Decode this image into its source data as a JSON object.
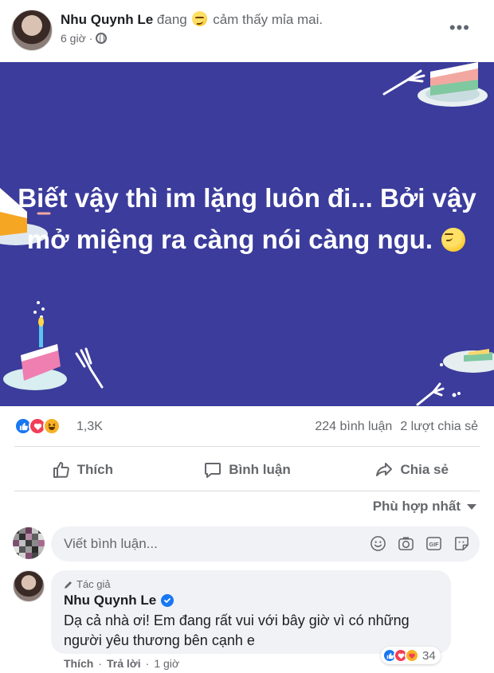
{
  "post": {
    "author": "Nhu Quynh Le",
    "feeling_prefix": "đang",
    "feeling_text": "cảm thấy mỉa mai.",
    "feeling_emoji": "smirk-emoji",
    "time": "6 giờ",
    "separator": "·",
    "privacy_icon": "globe-icon",
    "more_label": "•••",
    "banner_text": "Biết vậy thì im lặng luôn đi... Bởi vậy mở miệng ra càng nói càng ngu.",
    "banner_bg": "#3b3c9b"
  },
  "stats": {
    "reaction_icons": [
      "like",
      "love",
      "haha"
    ],
    "reaction_count": "1,3K",
    "comments": "224 bình luận",
    "shares": "2 lượt chia sẻ"
  },
  "actions": {
    "like": "Thích",
    "comment": "Bình luận",
    "share": "Chia sẻ"
  },
  "sort": {
    "label": "Phù hợp nhất"
  },
  "composer": {
    "placeholder": "Viết bình luận...",
    "icons": [
      "emoji-icon",
      "camera-icon",
      "gif-icon",
      "sticker-icon"
    ]
  },
  "comment": {
    "badge": "Tác giả",
    "author": "Nhu Quynh Le",
    "text": "Dạ cả nhà ơi! Em đang rất vui với bây giờ vì có những người yêu thương bên cạnh e",
    "reaction_icons": [
      "like",
      "love",
      "care"
    ],
    "reaction_count": "34",
    "like_label": "Thích",
    "reply_label": "Trả lời",
    "time": "1 giờ"
  },
  "colors": {
    "facebook_blue": "#1877f2",
    "text_secondary": "#65676b",
    "bubble_bg": "#f0f2f5"
  }
}
